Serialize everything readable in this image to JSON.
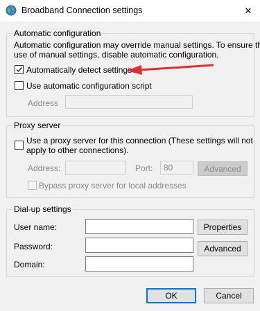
{
  "window": {
    "title": "Broadband Connection settings",
    "close_glyph": "✕"
  },
  "auto_config": {
    "group_label": "Automatic configuration",
    "description_line1": "Automatic configuration may override manual settings.  To ensure the",
    "description_line2": "use of manual settings, disable automatic configuration.",
    "auto_detect_label": "Automatically detect settings",
    "auto_detect_checked": true,
    "use_script_label": "Use automatic configuration script",
    "use_script_checked": false,
    "address_label": "Address",
    "address_value": ""
  },
  "proxy": {
    "group_label": "Proxy server",
    "use_proxy_line1": "Use a proxy server for this connection (These settings will not",
    "use_proxy_line2": "apply to other connections).",
    "use_proxy_checked": false,
    "address_label": "Address:",
    "address_value": "",
    "port_label": "Port:",
    "port_value": "80",
    "advanced_label": "Advanced",
    "bypass_label": "Bypass proxy server for local addresses",
    "bypass_checked": false
  },
  "dialup": {
    "group_label": "Dial-up settings",
    "username_label": "User name:",
    "username_value": "",
    "password_label": "Password:",
    "password_value": "",
    "domain_label": "Domain:",
    "domain_value": "",
    "properties_label": "Properties",
    "advanced_label": "Advanced"
  },
  "footer": {
    "ok_label": "OK",
    "cancel_label": "Cancel"
  },
  "colors": {
    "annotation_arrow": "#e03030",
    "accent": "#0078d7"
  }
}
